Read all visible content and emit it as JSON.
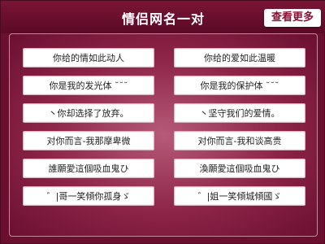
{
  "header": {
    "title": "情侣网名一对",
    "more_button": "查看更多"
  },
  "items": [
    {
      "left": "你给的情如此动人",
      "right": "你给的爱如此温暖"
    },
    {
      "left": "你是我的发光体 ˘˘˘",
      "right": "你是我的保护体 ˘˘˘"
    },
    {
      "left": "丶你却选择了放弃。",
      "right": "丶坚守我们的爱情。"
    },
    {
      "left": "对你而言-我那摩卑微",
      "right": "对你而言-我和谈高贵"
    },
    {
      "left": "誰願愛這個吸血鬼ひ",
      "right": "渙願愛這個吸血鬼ひ"
    },
    {
      "left": "゛|哥一笑傾你孤身ゞ",
      "right": "゛|姐一笑傾城傾國ゞ"
    }
  ]
}
